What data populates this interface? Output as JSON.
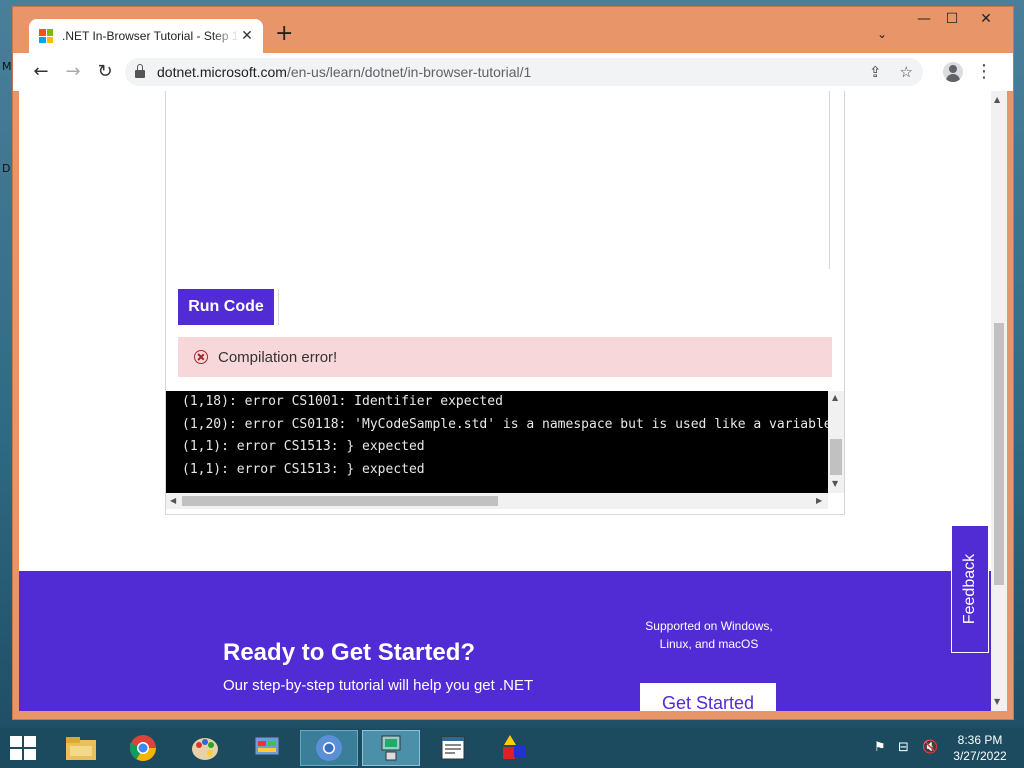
{
  "desktop": {
    "edge_letters": [
      "M",
      "D"
    ]
  },
  "browser": {
    "tab_title": ".NET In-Browser Tutorial - Step 1",
    "tab_close": "✕",
    "new_tab": "+",
    "tab_search": "⌄",
    "window_controls": {
      "minimize": "—",
      "maximize": "☐",
      "close": "✕"
    },
    "nav": {
      "back": "←",
      "forward": "→",
      "reload": "↻"
    },
    "url_host": "dotnet.microsoft.com",
    "url_path": "/en-us/learn/dotnet/in-browser-tutorial/1",
    "share_icon": "⇪",
    "bookmark_icon": "☆",
    "menu_icon": "⋮"
  },
  "page": {
    "run_button": "Run Code",
    "alert": {
      "text": "Compilation error!",
      "color": "#f8d7da"
    },
    "console_lines": [
      "(1,18): error CS1001: Identifier expected",
      "(1,20): error CS0118: 'MyCodeSample.std' is a namespace but is used like a variable",
      "(1,1): error CS1513: } expected",
      "(1,1): error CS1513: } expected"
    ],
    "cta": {
      "title": "Ready to Get Started?",
      "body": "Our step-by-step tutorial will help you get .NET",
      "support_line1": "Supported on Windows,",
      "support_line2": "Linux, and macOS",
      "button": "Get Started",
      "color": "#512bd4"
    },
    "feedback": "Feedback"
  },
  "taskbar": {
    "clock_time": "8:36 PM",
    "clock_date": "3/27/2022"
  }
}
